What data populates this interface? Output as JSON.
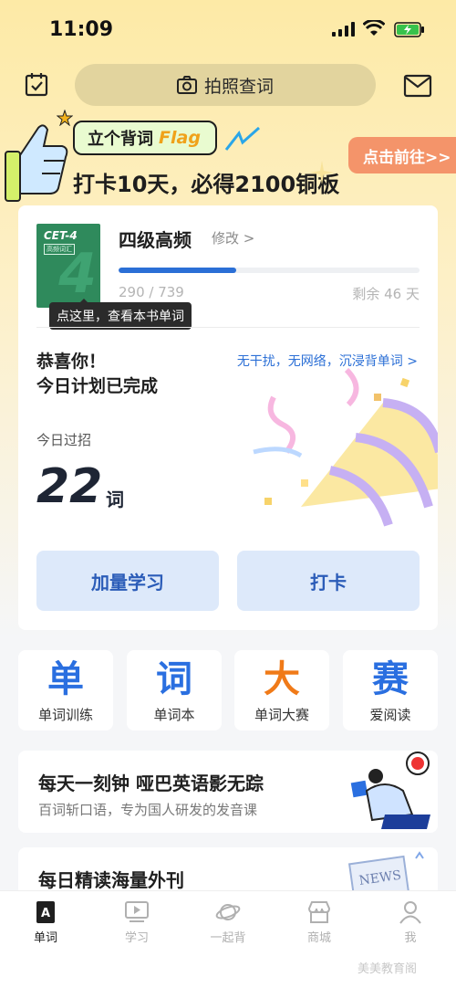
{
  "status_bar": {
    "time": "11:09"
  },
  "top_bar": {
    "search_label": "拍照查词"
  },
  "banner": {
    "flag_text": "立个背词",
    "flag_word": "Flag",
    "promo": "打卡10天，必得2100铜板",
    "goto": "点击前往>>"
  },
  "book": {
    "cover_title": "CET-4",
    "cover_sub": "高频词汇",
    "cover_big": "4",
    "tooltip": "点这里，查看本书单词",
    "title": "四级高频",
    "edit": "修改 >",
    "progress_fraction": 0.39,
    "count": "290 / 739",
    "remaining": "剩余 46 天"
  },
  "plan": {
    "congrats_line1": "恭喜你！",
    "congrats_line2": "今日计划已完成",
    "offline_link": "无干扰，无网络，沉浸背单词 >",
    "today_label": "今日过招",
    "today_count": "22",
    "today_unit": "词",
    "btn_more": "加量学习",
    "btn_checkin": "打卡"
  },
  "features": [
    {
      "glyph": "单",
      "label": "单词训练",
      "color": "#2a6fe0"
    },
    {
      "glyph": "词",
      "label": "单词本",
      "color": "#2a6fe0"
    },
    {
      "glyph": "大",
      "label": "单词大赛",
      "color": "#f07a18"
    },
    {
      "glyph": "赛",
      "label": "爱阅读",
      "color": "#2a6fe0"
    }
  ],
  "promos": [
    {
      "title": "每天一刻钟 哑巴英语影无踪",
      "subtitle": "百词斩口语，专为国人研发的发音课"
    },
    {
      "title": "每日精读海量外刊",
      "subtitle": ""
    }
  ],
  "tabs": [
    {
      "label": "单词",
      "icon": "book-a-icon",
      "active": true
    },
    {
      "label": "学习",
      "icon": "play-screen-icon",
      "active": false
    },
    {
      "label": "一起背",
      "icon": "planet-icon",
      "active": false
    },
    {
      "label": "商城",
      "icon": "shop-icon",
      "active": false
    },
    {
      "label": "我",
      "icon": "person-icon",
      "active": false
    }
  ],
  "watermark": "美美教育阁"
}
